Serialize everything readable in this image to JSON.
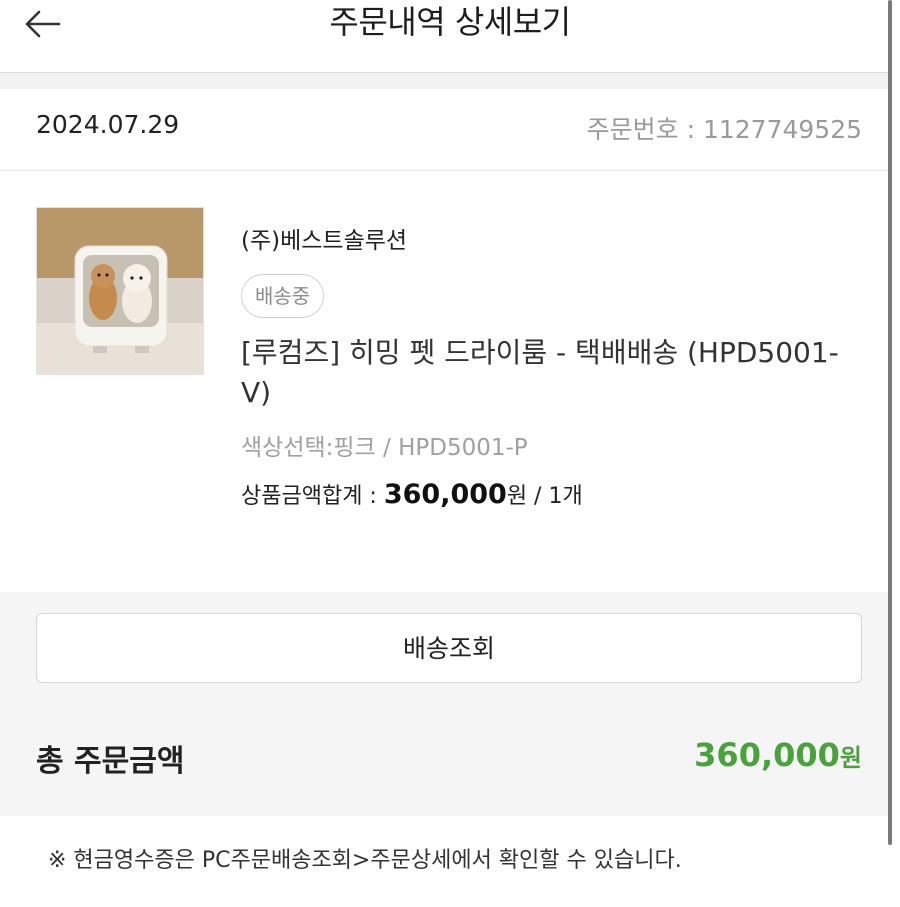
{
  "header": {
    "title": "주문내역 상세보기",
    "back_icon": "arrow-left-icon"
  },
  "order": {
    "date": "2024.07.29",
    "order_number": "주문번호 : 1127749525"
  },
  "item": {
    "seller": "(주)베스트솔루션",
    "status_badge": "배송중",
    "product_name": "[루컴즈] 히밍 펫 드라이룸 - 택배배송 (HPD5001-V)",
    "option": "색상선택:핑크 / HPD5001-P",
    "price_label": "상품금액합계 : ",
    "price_value": "360,000",
    "price_suffix": "원 / 1개"
  },
  "actions": {
    "tracking_button": "배송조회"
  },
  "total": {
    "label": "총 주문금액",
    "amount": "360,000",
    "unit": "원",
    "accent_color": "#4aa23c"
  },
  "notice": "※ 현금영수증은 PC주문배송조회>주문상세에서 확인할 수 있습니다."
}
